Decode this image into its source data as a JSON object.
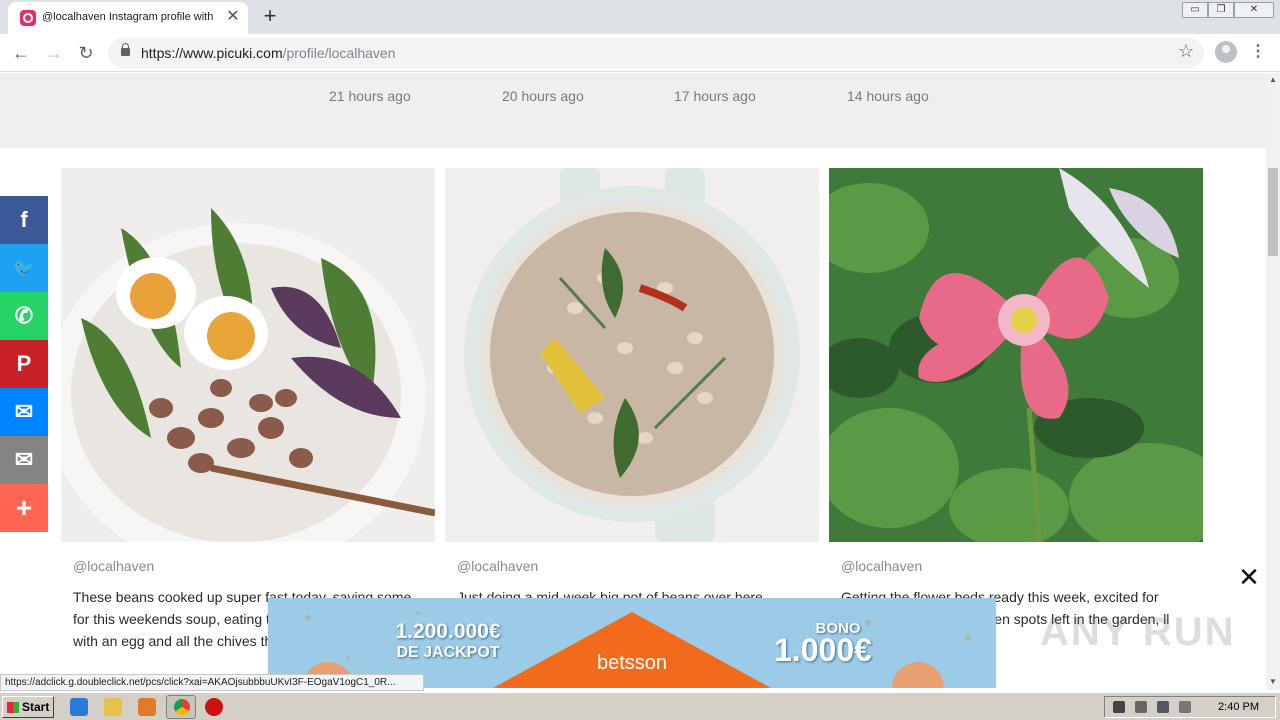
{
  "browser": {
    "tab_title": "@localhaven Instagram profile with p",
    "tab_close": "✕",
    "new_tab": "+",
    "url_domain": "https://www.picuki.com",
    "url_path": "/profile/localhaven",
    "window_min": "▭",
    "window_restore": "❐",
    "window_close": "✕",
    "back": "←",
    "forward": "→",
    "reload": "↻",
    "star": "☆",
    "menu": "⋮"
  },
  "timestamps": [
    "21 hours ago",
    "20 hours ago",
    "17 hours ago",
    "14 hours ago"
  ],
  "posts": [
    {
      "user": "@localhaven",
      "text": "These beans cooked up super fast today, saving some for this weekends soup, eating them a little creamy with an egg and all the chives that",
      "image": "bowl-of-beans-eggs-greens"
    },
    {
      "user": "@localhaven",
      "text": "Just doing a mid-week big pot of beans over here",
      "image": "pot-of-beans-herbs"
    },
    {
      "user": "@localhaven",
      "text": "Getting the flower beds ready this week, excited for come, especially these pen spots left in the garden, ll me your favorites.",
      "image": "pink-poppy-flower"
    }
  ],
  "share": [
    {
      "name": "facebook",
      "glyph": "f",
      "color": "#3b5998"
    },
    {
      "name": "twitter",
      "glyph": "🐦",
      "color": "#1da1f2"
    },
    {
      "name": "whatsapp",
      "glyph": "✆",
      "color": "#25d366"
    },
    {
      "name": "pinterest",
      "glyph": "P",
      "color": "#cb2027"
    },
    {
      "name": "messenger",
      "glyph": "✉",
      "color": "#0084ff"
    },
    {
      "name": "email",
      "glyph": "✉",
      "color": "#848484"
    },
    {
      "name": "more",
      "glyph": "+",
      "color": "#ff6550"
    }
  ],
  "ad": {
    "jackpot_amount": "1.200.000€",
    "jackpot_label": "DE JACKPOT",
    "bono_label": "BONO",
    "bono_amount": "1.000€",
    "brand": "betsson",
    "close": "✕"
  },
  "status_url": "https://adclick.g.doubleclick.net/pcs/click?xai=AKAOjsubbbuUKvI3F-EOgaV1ogC1_0R...",
  "taskbar": {
    "start": "Start",
    "clock": "2:40 PM"
  },
  "watermark": "ANY RUN"
}
